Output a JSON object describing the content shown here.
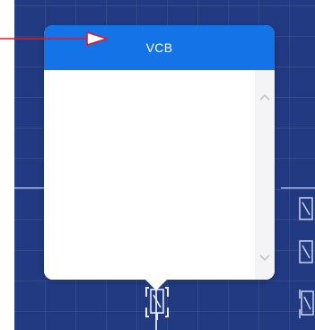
{
  "popup": {
    "title": "VCB",
    "header_color": "#1473e6"
  },
  "icons": {
    "scroll_up": "chevron-up-icon",
    "scroll_down": "chevron-down-icon",
    "breaker": "breaker-symbol-icon",
    "pointer_arrow": "red-arrow-icon"
  },
  "colors": {
    "canvas_background": "#213a82",
    "arrow": "#e01b24"
  }
}
